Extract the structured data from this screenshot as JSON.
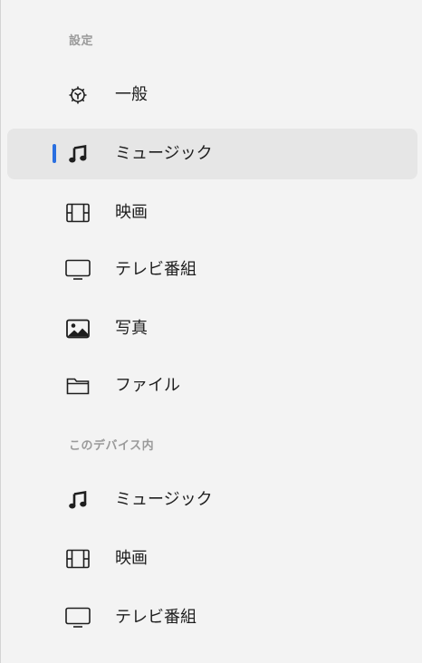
{
  "sidebar": {
    "settings_header": "設定",
    "settings_items": [
      {
        "label": "一般",
        "icon": "gear-icon"
      },
      {
        "label": "ミュージック",
        "icon": "music-note-icon"
      },
      {
        "label": "映画",
        "icon": "film-icon"
      },
      {
        "label": "テレビ番組",
        "icon": "tv-icon"
      },
      {
        "label": "写真",
        "icon": "photo-icon"
      },
      {
        "label": "ファイル",
        "icon": "folder-icon"
      }
    ],
    "device_header": "このデバイス内",
    "device_items": [
      {
        "label": "ミュージック",
        "icon": "music-note-icon"
      },
      {
        "label": "映画",
        "icon": "film-icon"
      },
      {
        "label": "テレビ番組",
        "icon": "tv-icon"
      }
    ],
    "selected_item": "ミュージック",
    "colors": {
      "background": "#f3f3f3",
      "selected_background": "#e6e6e6",
      "accent": "#2a6fe0",
      "header_text": "#9a9a9a",
      "item_text": "#1e1e1e"
    }
  }
}
